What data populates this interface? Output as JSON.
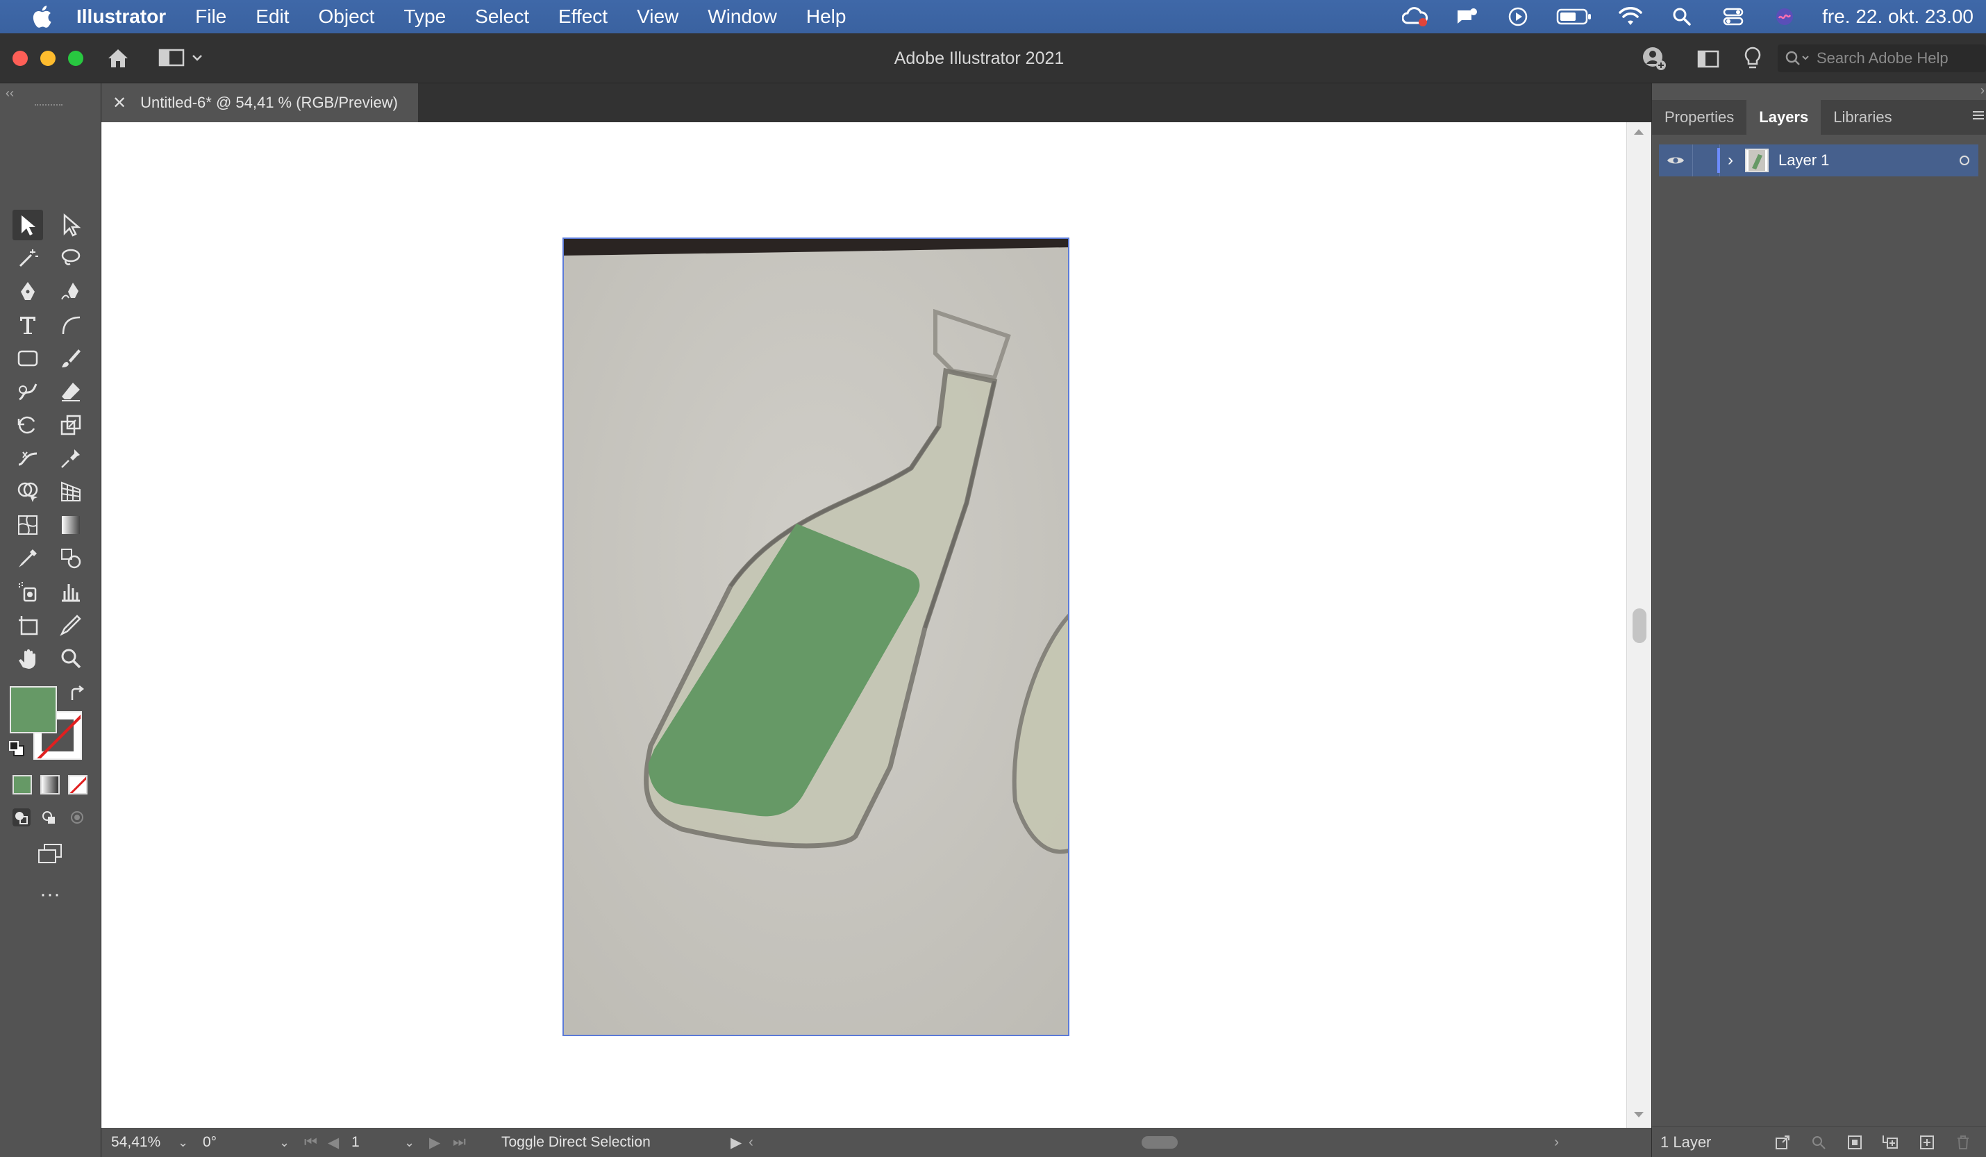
{
  "menubar": {
    "app_name": "Illustrator",
    "items": [
      "File",
      "Edit",
      "Object",
      "Type",
      "Select",
      "Effect",
      "View",
      "Window",
      "Help"
    ],
    "datetime": "fre. 22. okt. 23.00"
  },
  "appbar": {
    "title": "Adobe Illustrator 2021",
    "search_placeholder": "Search Adobe Help"
  },
  "document_tab": {
    "label": "Untitled-6* @ 54,41 % (RGB/Preview)"
  },
  "colors": {
    "fill": "#669966",
    "accent": "#5b7ad8",
    "selection_row": "#46608d"
  },
  "panel": {
    "tabs": [
      "Properties",
      "Layers",
      "Libraries"
    ],
    "active_tab": "Layers",
    "layer_name": "Layer 1",
    "layer_count": "1 Layer"
  },
  "status": {
    "zoom": "54,41%",
    "rotation": "0°",
    "artboard_number": "1",
    "message": "Toggle Direct Selection"
  }
}
